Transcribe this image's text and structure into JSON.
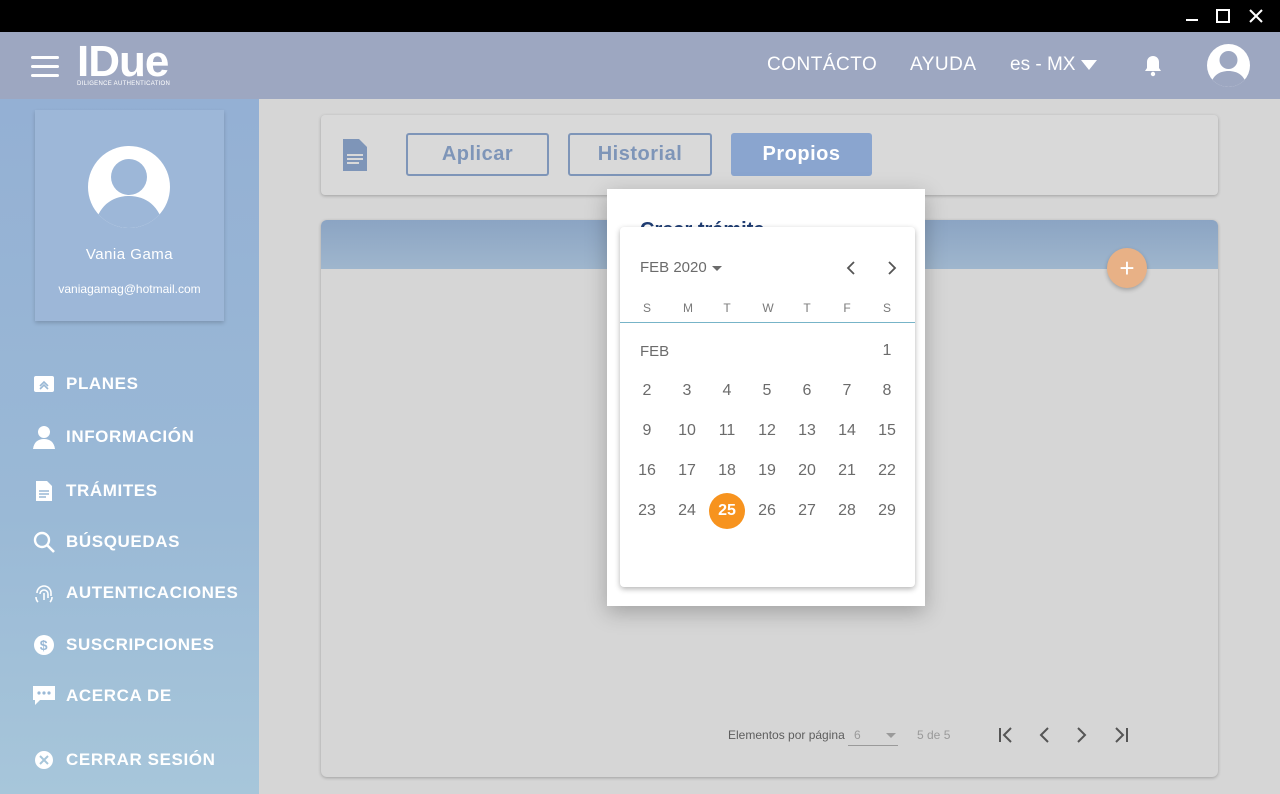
{
  "window": {
    "minimize_icon": "minimize-icon",
    "maximize_icon": "maximize-icon",
    "close_icon": "close-icon"
  },
  "header": {
    "logo_text": "IDue",
    "logo_subtitle": "DILIGENCE AUTHENTICATION",
    "nav": [
      {
        "label": "CONTÁCTO"
      },
      {
        "label": "AYUDA"
      }
    ],
    "language": "es - MX"
  },
  "profile": {
    "name": "Vania Gama",
    "email": "vaniagamag@hotmail.com"
  },
  "sidebar": {
    "items": [
      {
        "label": "PLANES",
        "icon": "plans-icon"
      },
      {
        "label": "INFORMACIÓN",
        "icon": "person-icon"
      },
      {
        "label": "TRÁMITES",
        "icon": "document-icon"
      },
      {
        "label": "BÚSQUEDAS",
        "icon": "search-icon"
      },
      {
        "label": "AUTENTICACIONES",
        "icon": "fingerprint-icon"
      },
      {
        "label": "SUSCRIPCIONES",
        "icon": "dollar-icon"
      },
      {
        "label": "ACERCA DE",
        "icon": "chat-icon"
      },
      {
        "label": "CERRAR SESIÓN",
        "icon": "close-circle-icon"
      }
    ]
  },
  "toolbar": {
    "buttons": [
      {
        "label": "Aplicar"
      },
      {
        "label": "Historial"
      },
      {
        "label": "Propios"
      }
    ]
  },
  "pagination": {
    "items_per_page_label": "Elementos por página",
    "items_per_page_value": "6",
    "range": "5 de 5"
  },
  "dialog": {
    "title": "Crear trámite"
  },
  "calendar": {
    "period_label": "FEB 2020",
    "weekdays": [
      "S",
      "M",
      "T",
      "W",
      "T",
      "F",
      "S"
    ],
    "month_label": "FEB",
    "weeks": [
      [
        "",
        "",
        "",
        "",
        "",
        "",
        "1"
      ],
      [
        "2",
        "3",
        "4",
        "5",
        "6",
        "7",
        "8"
      ],
      [
        "9",
        "10",
        "11",
        "12",
        "13",
        "14",
        "15"
      ],
      [
        "16",
        "17",
        "18",
        "19",
        "20",
        "21",
        "22"
      ],
      [
        "23",
        "24",
        "25",
        "26",
        "27",
        "28",
        "29"
      ]
    ],
    "selected_day": "25"
  },
  "colors": {
    "selected_day": "#f7931e",
    "header": "#9da7c1",
    "accent_blue": "#8aa5cf"
  }
}
